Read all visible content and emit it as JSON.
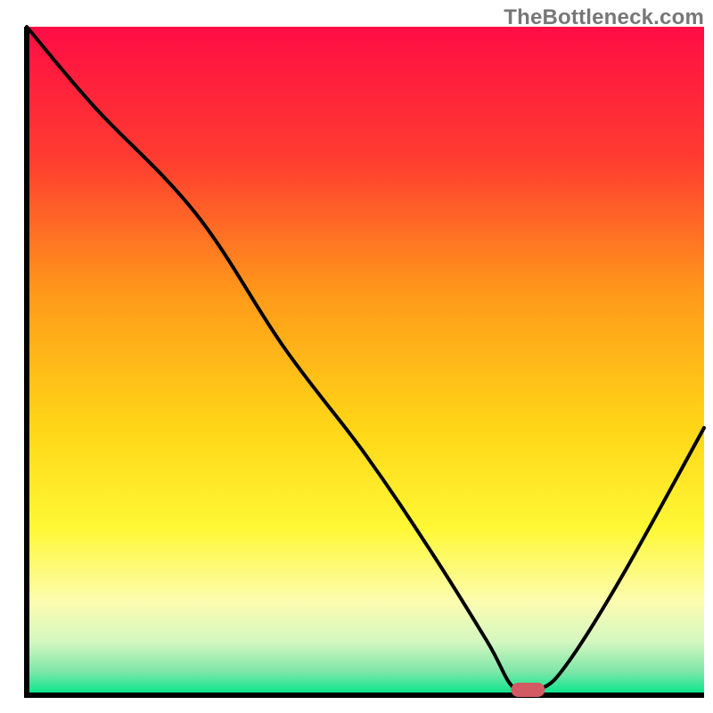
{
  "watermark": "TheBottleneck.com",
  "chart_data": {
    "type": "line",
    "title": "",
    "xlabel": "",
    "ylabel": "",
    "xlim": [
      0,
      100
    ],
    "ylim": [
      0,
      100
    ],
    "x": [
      0,
      10,
      25,
      38,
      50,
      60,
      68,
      72,
      76,
      80,
      88,
      100
    ],
    "values": [
      100,
      88,
      72,
      52,
      36,
      21,
      8,
      1,
      1,
      5,
      18,
      40
    ],
    "marker": {
      "x": 74,
      "y": 0.8
    },
    "gradient_stops": [
      {
        "offset": 0.0,
        "color": "#ff0d45"
      },
      {
        "offset": 0.2,
        "color": "#ff3d30"
      },
      {
        "offset": 0.4,
        "color": "#ff9a1a"
      },
      {
        "offset": 0.6,
        "color": "#ffd617"
      },
      {
        "offset": 0.75,
        "color": "#fff835"
      },
      {
        "offset": 0.86,
        "color": "#fcfcb0"
      },
      {
        "offset": 0.92,
        "color": "#d4f7c0"
      },
      {
        "offset": 0.965,
        "color": "#7de6a8"
      },
      {
        "offset": 1.0,
        "color": "#00e58b"
      }
    ],
    "axes_color": "#000000",
    "curve_color": "#000000",
    "marker_color": "#d35a63"
  }
}
